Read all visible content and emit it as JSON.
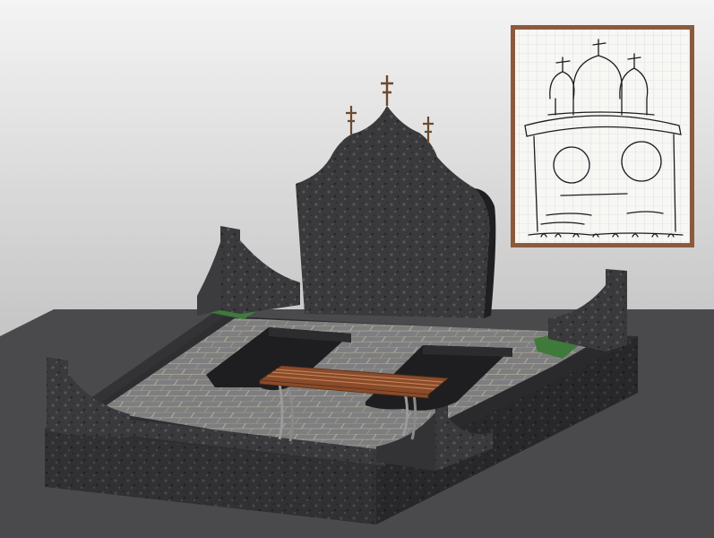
{
  "scene": {
    "subject": "granite-memorial-complex",
    "colors": {
      "background_top": "#f2f2f2",
      "background_bottom": "#a9a9a9",
      "floor": "#4a4a4c",
      "granite_dark": "#2b2b2d",
      "granite_mid": "#3c3c3f",
      "granite_light": "#5a5a5e",
      "paving": "#7f7f7f",
      "paving_joint": "#b4b098",
      "grass": "#3f7a3a",
      "bench_wood": "#8a4b2a",
      "bench_leg": "#9a9a9a",
      "cross": "#6b4a2e",
      "sketch_frame": "#8b5a3c",
      "sketch_paper": "#f7f7f4",
      "sketch_grid": "#c9d4de",
      "sketch_ink": "#1d1d1f"
    }
  }
}
